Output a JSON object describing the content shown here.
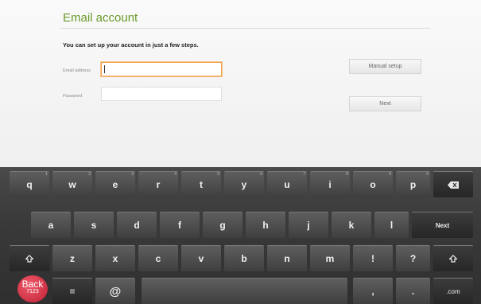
{
  "header": {
    "title": "Email account"
  },
  "form": {
    "intro": "You can set up your account in just a few steps.",
    "email_label": "Email address",
    "email_value": "",
    "password_label": "Password",
    "password_value": "",
    "manual_setup_label": "Manual setup",
    "next_label": "Next"
  },
  "keyboard": {
    "row1": [
      "q",
      "w",
      "e",
      "r",
      "t",
      "y",
      "u",
      "i",
      "o",
      "p"
    ],
    "row1_hints": [
      "1",
      "2",
      "3",
      "4",
      "5",
      "6",
      "7",
      "8",
      "9",
      "0"
    ],
    "row2": [
      "a",
      "s",
      "d",
      "f",
      "g",
      "h",
      "j",
      "k",
      "l"
    ],
    "next_key": "Next",
    "row3": [
      "z",
      "x",
      "c",
      "v",
      "b",
      "n",
      "m",
      "!",
      "?"
    ],
    "at_key": "@",
    "comma_key": ",",
    "period_key": ".",
    "com_key": ".com",
    "shift_icon": "shift-arrow-icon",
    "backspace_icon": "backspace-icon",
    "settings_icon": "keyboard-settings-icon"
  },
  "overlay": {
    "back_label": "Back",
    "back_sub": "7123"
  }
}
